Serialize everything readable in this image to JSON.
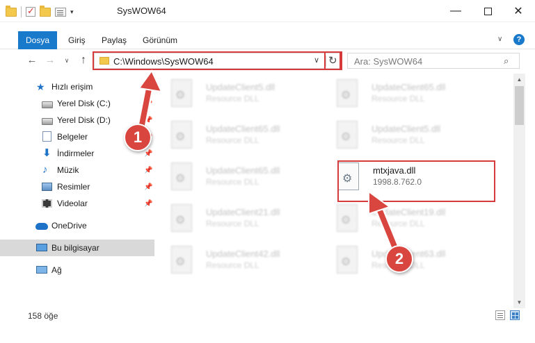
{
  "window": {
    "title": "SysWOW64",
    "minimize_glyph": "—",
    "close_glyph": "✕"
  },
  "ribbon": {
    "tabs": [
      {
        "label": "Dosya"
      },
      {
        "label": "Giriş"
      },
      {
        "label": "Paylaş"
      },
      {
        "label": "Görünüm"
      }
    ],
    "help_glyph": "?",
    "expand_glyph": "∨"
  },
  "nav": {
    "back_glyph": "←",
    "forward_glyph": "→",
    "recent_glyph": "∨",
    "up_glyph": "↑",
    "address": "C:\\Windows\\SysWOW64",
    "address_dropdown_glyph": "∨",
    "refresh_glyph": "↻",
    "search_placeholder": "Ara: SysWOW64",
    "search_glyph": "⌕"
  },
  "sidebar": {
    "quick_access": "Hızlı erişim",
    "items": [
      {
        "label": "Yerel Disk (C:)",
        "icon": "disk-icon",
        "pinned": true
      },
      {
        "label": "Yerel Disk (D:)",
        "icon": "disk-icon",
        "pinned": true
      },
      {
        "label": "Belgeler",
        "icon": "document-icon",
        "pinned": true
      },
      {
        "label": "İndirmeler",
        "icon": "download-icon",
        "pinned": true
      },
      {
        "label": "Müzik",
        "icon": "music-icon",
        "pinned": true
      },
      {
        "label": "Resimler",
        "icon": "picture-icon",
        "pinned": true
      },
      {
        "label": "Videolar",
        "icon": "video-icon",
        "pinned": true
      }
    ],
    "onedrive": "OneDrive",
    "this_pc": "Bu bilgisayar",
    "network": "Ağ",
    "pin_glyph": "📌",
    "star_glyph": "★",
    "download_glyph": "⬇",
    "music_glyph": "♪"
  },
  "files": [
    {
      "name": "UpdateClient5.dll",
      "desc": "Resource DLL"
    },
    {
      "name": "UpdateClient65.dll",
      "desc": "Resource DLL"
    },
    {
      "name": "UpdateClient65.dll",
      "desc": "Resource DLL"
    },
    {
      "name": "UpdateClient5.dll",
      "desc": "Resource DLL"
    },
    {
      "name": "UpdateClient65.dll",
      "desc": "Resource DLL"
    },
    {
      "name": "mtxjava.dll",
      "desc": "1998.8.762.0"
    },
    {
      "name": "UpdateClient21.dll",
      "desc": "Resource DLL"
    },
    {
      "name": "UpdateClient19.dll",
      "desc": "Resource DLL"
    },
    {
      "name": "UpdateClient42.dll",
      "desc": "Resource DLL"
    },
    {
      "name": "UpdateClient63.dll",
      "desc": "Resource DLL"
    }
  ],
  "callouts": {
    "badge_1": "1",
    "badge_2": "2"
  },
  "status": {
    "item_count": "158 öğe"
  },
  "scrollbar": {
    "up_glyph": "▲",
    "down_glyph": "▼"
  },
  "colors": {
    "accent": "#1979ca",
    "highlight": "#d63a3a",
    "badge": "#d9463f"
  }
}
